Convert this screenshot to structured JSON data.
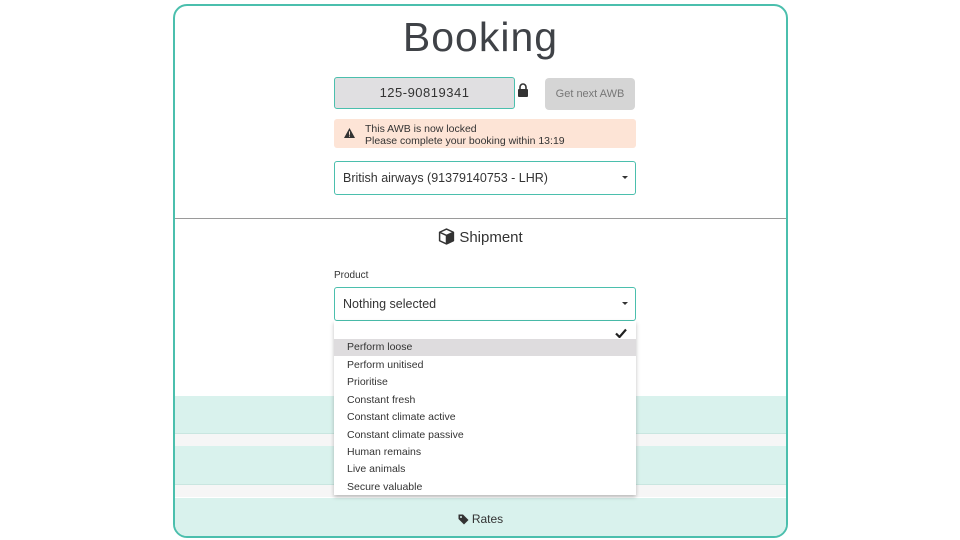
{
  "page": {
    "title": "Booking"
  },
  "awb": {
    "value": "125-90819341",
    "next_button": "Get next AWB"
  },
  "alert": {
    "line1": "This AWB is now locked",
    "line2": "Please complete your booking within 13:19"
  },
  "airline_select": {
    "value": "British airways (91379140753 - LHR)"
  },
  "shipment": {
    "heading": "Shipment",
    "product_label": "Product",
    "product_value": "Nothing selected",
    "options": [
      "Perform loose",
      "Perform unitised",
      "Prioritise",
      "Constant fresh",
      "Constant climate active",
      "Constant climate passive",
      "Human remains",
      "Live animals",
      "Secure valuable"
    ],
    "highlighted_option": "Perform loose"
  },
  "rates": {
    "label": "Rates"
  },
  "colors": {
    "accent": "#4bbfad",
    "band": "#d9f2ed",
    "alert_bg": "#fde4d6",
    "highlight": "#dedcde"
  },
  "icons": {
    "lock": "lock-icon",
    "warning": "warning-icon",
    "shipment": "cube-icon",
    "rates": "tag-icon",
    "selected": "check-icon"
  }
}
